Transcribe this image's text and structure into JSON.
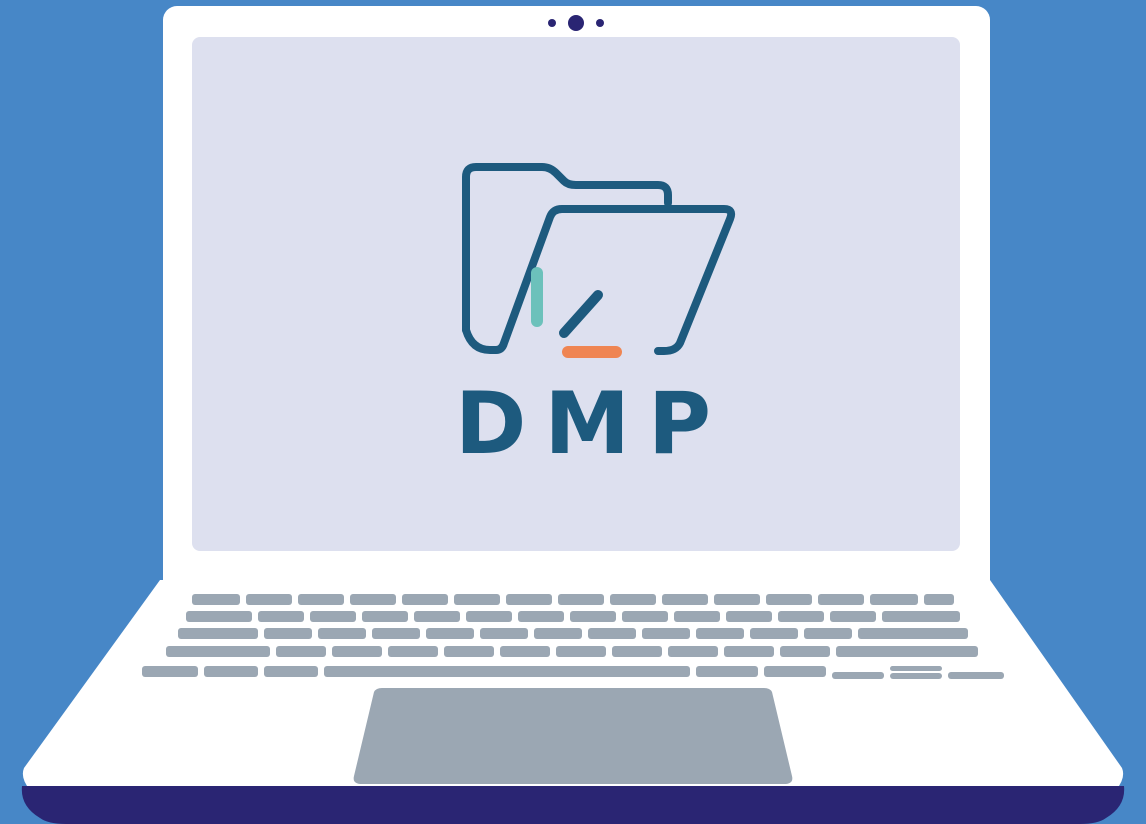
{
  "logo": {
    "text": "DMP",
    "colors": {
      "primary": "#1d5a7e",
      "accent_teal": "#6cc1bb",
      "accent_orange": "#ef8552"
    },
    "icon": "folder-with-checkmark-icon"
  },
  "device": {
    "type": "laptop",
    "body_color": "#ffffff",
    "screen_color": "#dde0ef",
    "key_color": "#9ba7b3",
    "base_edge_color": "#2a2573",
    "background_color": "#4787c7"
  }
}
